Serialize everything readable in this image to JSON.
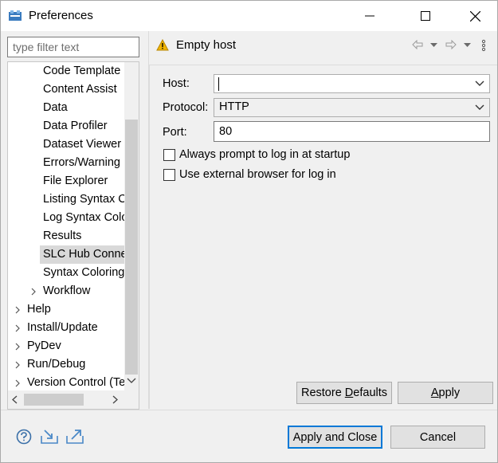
{
  "window": {
    "title": "Preferences",
    "icons": [
      "app-icon",
      "minimize-icon",
      "maximize-icon",
      "close-icon"
    ]
  },
  "filter": {
    "placeholder": "type filter text",
    "value": ""
  },
  "tree": {
    "items": [
      {
        "label": "Code Template",
        "level": 2,
        "expandable": false,
        "selected": false
      },
      {
        "label": "Content Assist",
        "level": 2,
        "expandable": false,
        "selected": false
      },
      {
        "label": "Data",
        "level": 2,
        "expandable": false,
        "selected": false
      },
      {
        "label": "Data Profiler",
        "level": 2,
        "expandable": false,
        "selected": false
      },
      {
        "label": "Dataset Viewer",
        "level": 2,
        "expandable": false,
        "selected": false
      },
      {
        "label": "Errors/Warning",
        "level": 2,
        "expandable": false,
        "selected": false
      },
      {
        "label": "File Explorer",
        "level": 2,
        "expandable": false,
        "selected": false
      },
      {
        "label": "Listing Syntax C",
        "level": 2,
        "expandable": false,
        "selected": false
      },
      {
        "label": "Log Syntax Colo",
        "level": 2,
        "expandable": false,
        "selected": false
      },
      {
        "label": "Results",
        "level": 2,
        "expandable": false,
        "selected": false
      },
      {
        "label": "SLC Hub Conne",
        "level": 2,
        "expandable": false,
        "selected": true
      },
      {
        "label": "Syntax Coloring",
        "level": 2,
        "expandable": false,
        "selected": false
      },
      {
        "label": "Workflow",
        "level": 2,
        "expandable": true,
        "selected": false
      },
      {
        "label": "Help",
        "level": 1,
        "expandable": true,
        "selected": false
      },
      {
        "label": "Install/Update",
        "level": 1,
        "expandable": true,
        "selected": false
      },
      {
        "label": "PyDev",
        "level": 1,
        "expandable": true,
        "selected": false
      },
      {
        "label": "Run/Debug",
        "level": 1,
        "expandable": true,
        "selected": false
      },
      {
        "label": "Version Control (Te",
        "level": 1,
        "expandable": true,
        "selected": false
      }
    ]
  },
  "page": {
    "title": "Empty host",
    "title_icon": "warning-icon",
    "nav_icons": [
      "back-icon",
      "back-menu-icon",
      "forward-icon",
      "forward-menu-icon",
      "more-icon"
    ]
  },
  "form": {
    "host_label": "Host:",
    "host_value": "",
    "protocol_label": "Protocol:",
    "protocol_value": "HTTP",
    "port_label": "Port:",
    "port_value": "80",
    "always_prompt_label": "Always prompt to log in at startup",
    "always_prompt_checked": false,
    "external_browser_label": "Use external browser for log in",
    "external_browser_checked": false
  },
  "buttons": {
    "restore_defaults_prefix": "Restore ",
    "restore_defaults_mnemonic": "D",
    "restore_defaults_suffix": "efaults",
    "apply_mnemonic": "A",
    "apply_suffix": "pply",
    "apply_and_close": "Apply and Close",
    "cancel": "Cancel"
  },
  "footer_icons": [
    "help-icon",
    "import-icon",
    "export-icon"
  ],
  "colors": {
    "accent": "#0078d7",
    "warning": "#f0b400",
    "selection": "#d9d9d9",
    "icon_blue": "#3a7bbf"
  }
}
